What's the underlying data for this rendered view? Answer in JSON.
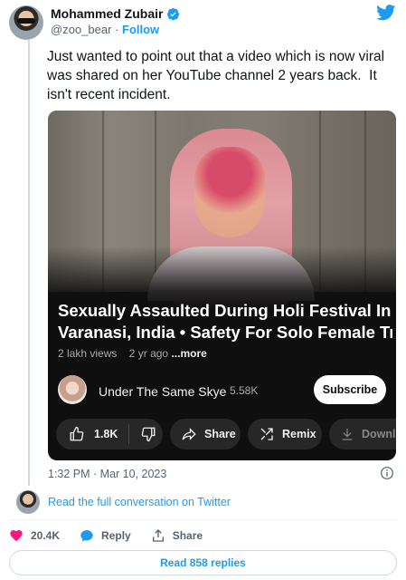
{
  "author": {
    "name": "Mohammed Zubair",
    "handle": "@zoo_bear",
    "separator": "·",
    "follow_label": "Follow"
  },
  "tweet": {
    "text": "Just wanted to point out that a video which is now viral was shared on her YouTube channel 2 years back.  It isn't recent incident."
  },
  "video_card": {
    "title_line1": "Sexually Assaulted During Holi Festival In",
    "title_line2": "Varanasi, India • Safety For Solo Female Tr...",
    "views": "2 lakh views",
    "age": "2 yr ago",
    "more_label": "...more",
    "channel_name": "Under The Same Skye",
    "subscribers": "5.58K",
    "subscribe_label": "Subscribe",
    "likes": "1.8K",
    "share_label": "Share",
    "remix_label": "Remix",
    "download_label": "Downlo"
  },
  "timestamp": "1:32 PM · Mar 10, 2023",
  "conversation_link": "Read the full conversation on Twitter",
  "stats": {
    "likes": "20.4K",
    "reply_label": "Reply",
    "share_label": "Share"
  },
  "replies_button": "Read 858 replies",
  "colors": {
    "accent": "#1d9bf0",
    "like_heart": "#f91880",
    "video_bg": "#0f0f0f"
  }
}
